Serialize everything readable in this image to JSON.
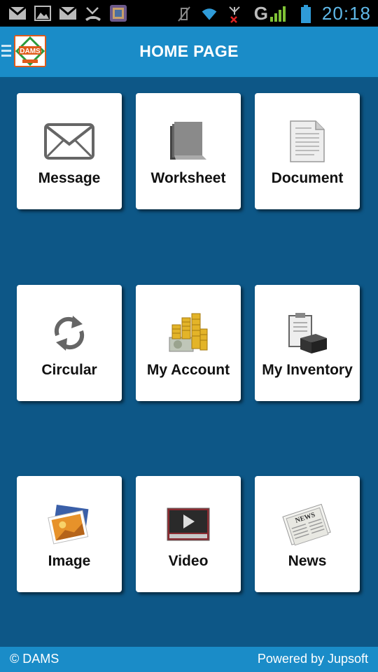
{
  "status_bar": {
    "time": "20:18",
    "network_label": "G"
  },
  "header": {
    "title": "HOME PAGE",
    "logo_text": "DAMS"
  },
  "tiles": [
    {
      "label": "Message",
      "icon": "envelope-icon"
    },
    {
      "label": "Worksheet",
      "icon": "worksheet-stack-icon"
    },
    {
      "label": "Document",
      "icon": "document-icon"
    },
    {
      "label": "Circular",
      "icon": "refresh-arrows-icon"
    },
    {
      "label": "My Account",
      "icon": "coins-money-icon"
    },
    {
      "label": "My Inventory",
      "icon": "clipboard-box-icon"
    },
    {
      "label": "Image",
      "icon": "photo-icon"
    },
    {
      "label": "Video",
      "icon": "video-player-icon"
    },
    {
      "label": "News",
      "icon": "newspaper-icon"
    }
  ],
  "footer": {
    "left": "© DAMS",
    "right": "Powered by Jupsoft"
  },
  "colors": {
    "background": "#0d5787",
    "header": "#1a8cc8",
    "tile": "#ffffff"
  }
}
